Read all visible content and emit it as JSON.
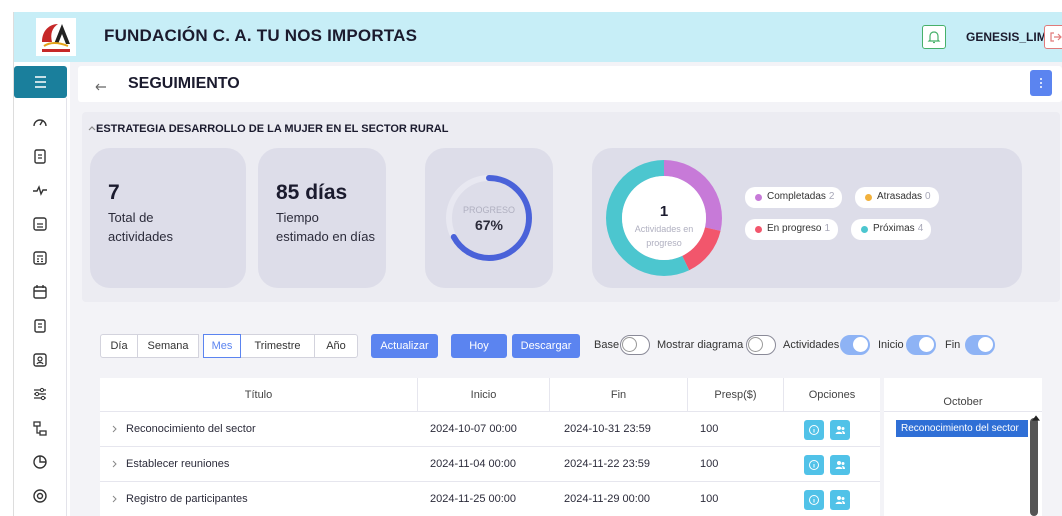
{
  "header": {
    "title": "FUNDACIÓN C. A. TU NOS IMPORTAS",
    "user": "GENESIS_LIM",
    "logo_icon": "foundation-logo",
    "bell_icon": "bell-icon",
    "logout_icon": "logout-icon"
  },
  "sidebar": {
    "menu_icon": "hamburger-icon",
    "items": [
      {
        "icon": "dashboard-icon"
      },
      {
        "icon": "clipboard-icon"
      },
      {
        "icon": "activity-icon"
      },
      {
        "icon": "calendar-grid-icon"
      },
      {
        "icon": "calculator-icon"
      },
      {
        "icon": "calendar-icon"
      },
      {
        "icon": "document-icon"
      },
      {
        "icon": "id-card-icon"
      },
      {
        "icon": "sliders-icon"
      },
      {
        "icon": "hierarchy-icon"
      },
      {
        "icon": "pie-chart-icon"
      },
      {
        "icon": "target-icon"
      }
    ]
  },
  "page": {
    "title": "SEGUIMIENTO",
    "back_icon": "arrow-left-icon",
    "options_icon": "kebab-icon"
  },
  "section": {
    "title": "ESTRATEGIA DESARROLLO DE LA MUJER EN EL SECTOR RURAL",
    "collapse_icon": "chevron-up-icon"
  },
  "stats": {
    "total_value": "7",
    "total_label_1": "Total de",
    "total_label_2": "actividades",
    "time_value": "85 días",
    "time_label_1": "Tiempo",
    "time_label_2": "estimado en días",
    "progress_label": "PROGRESO",
    "progress_text": "67%",
    "progress_fraction": 0.67
  },
  "donut": {
    "center_value": "1",
    "center_label_1": "Actividades en",
    "center_label_2": "progreso",
    "segments": [
      {
        "name": "Completadas",
        "value": 2,
        "color": "#c77ad8"
      },
      {
        "name": "Atrasadas",
        "value": 0,
        "color": "#f2b13c"
      },
      {
        "name": "En progreso",
        "value": 1,
        "color": "#f2566c"
      },
      {
        "name": "Próximas",
        "value": 4,
        "color": "#4cc6cf"
      }
    ]
  },
  "legend": {
    "completadas": "Completadas",
    "completadas_count": "2",
    "atrasadas": "Atrasadas",
    "atrasadas_count": "0",
    "en_progreso": "En progreso",
    "en_progreso_count": "1",
    "proximas": "Próximas",
    "proximas_count": "4"
  },
  "toolbar": {
    "views": [
      "Día",
      "Semana",
      "Mes",
      "Trimestre",
      "Año"
    ],
    "active_view": "Mes",
    "actualizar": "Actualizar",
    "hoy": "Hoy",
    "descargar": "Descargar",
    "toggles": [
      {
        "label": "Base",
        "on": false
      },
      {
        "label": "Mostrar diagrama",
        "on": false
      },
      {
        "label": "Actividades",
        "on": true
      },
      {
        "label": "Inicio",
        "on": true
      },
      {
        "label": "Fin",
        "on": true
      }
    ]
  },
  "table": {
    "headers": [
      "Título",
      "Inicio",
      "Fin",
      "Presp($)",
      "Opciones"
    ],
    "rows": [
      {
        "titulo": "Reconocimiento del sector",
        "inicio": "2024-10-07 00:00",
        "fin": "2024-10-31 23:59",
        "presp": "100"
      },
      {
        "titulo": "Establecer reuniones",
        "inicio": "2024-11-04 00:00",
        "fin": "2024-11-22 23:59",
        "presp": "100"
      },
      {
        "titulo": "Registro de participantes",
        "inicio": "2024-11-25 00:00",
        "fin": "2024-11-29 00:00",
        "presp": "100"
      }
    ],
    "expand_icon": "chevron-right-icon",
    "info_icon": "info-icon",
    "users_icon": "users-icon"
  },
  "gantt": {
    "month": "October",
    "bar_label": "Reconocimiento del sector"
  },
  "colors": {
    "header_bg": "#c7eef7",
    "primary": "#5b84f0",
    "teal": "#1a7f9c",
    "progress_ring": "#4a62d9"
  }
}
